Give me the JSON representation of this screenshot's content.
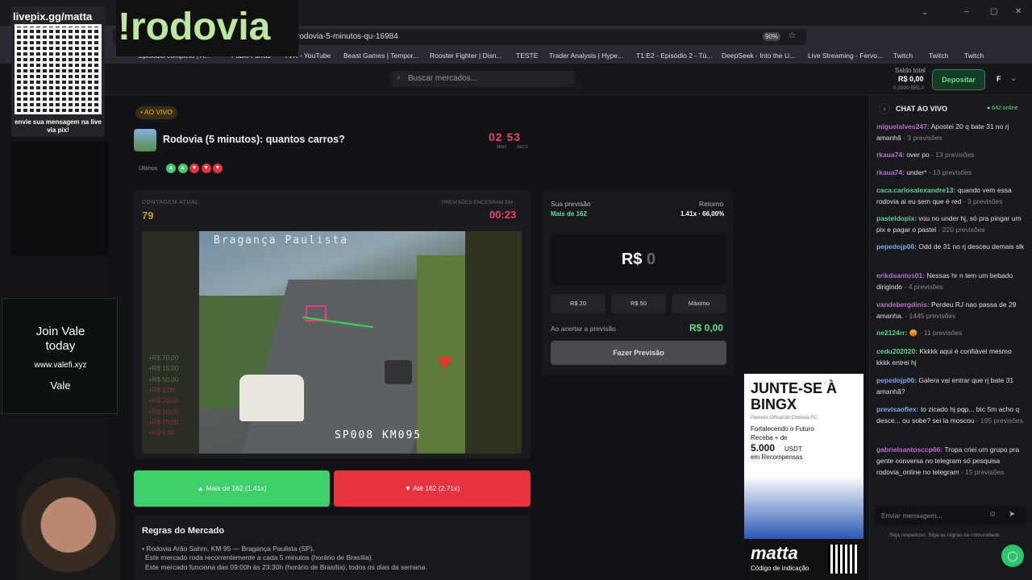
{
  "browser": {
    "url": "rodovia-5-minutos-qu-16984",
    "zoom": "90%",
    "bookmarks": [
      "Episódio completo | A...",
      "Páblo Furras",
      "YVR - YouTube",
      "Beast Games | Tempor...",
      "Rooster Fighter | Disn...",
      "TESTE",
      "Trader Analysis | Hype...",
      "T1:E2 - Episódio 2 - Tú...",
      "DeepSeek - Into the U...",
      "Live Streaming - Fervo...",
      "Twitch",
      "Twitch",
      "Twitch"
    ]
  },
  "header": {
    "search_placeholder": "Buscar mercados...",
    "saldo_label": "Saldo total",
    "saldo_value": "R$ 0,00",
    "saldo_sub": "0.0000 BRLX",
    "deposit": "Depositar",
    "user": "F"
  },
  "market": {
    "live_badge": "• AO VIVO",
    "title": "Rodovia (5 minutos): quantos carros?",
    "timer_min": "02",
    "timer_sec": "53",
    "timer_min_label": "MINS",
    "timer_sec_label": "SECS",
    "ultimos_label": "Últimos",
    "ultimos": [
      "up",
      "up",
      "down",
      "down",
      "down"
    ],
    "contagem_label": "CONTAGEM ATUAL",
    "contagem_value": "79",
    "prev_label": "PREVISÕES ENCERRAM EM",
    "prev_time": "00:23",
    "video_top": "Bragança Paulista",
    "video_bottom": "SP008 KM095",
    "multipliers": [
      "+R$ 70,00",
      "+R$ 15,00",
      "+R$ 50,00",
      "+R$ 2,00",
      "+R$ 20,00",
      "+R$ 10,00",
      "+R$ 10,00",
      "+R$ 5,00"
    ],
    "btn_up": "Mais de 162 (1.41x)",
    "btn_down": "Até 162 (2.71x)"
  },
  "rules": {
    "title": "Regras do Mercado",
    "lines": [
      "• Rodovia Arão Sahm, KM 95 — Bragança Paulista (SP).",
      "Este mercado roda recorrentemente a cada 5 minutos (horário de Brasília).",
      "Este mercado funciona das 09:00h às 23:30h (horário de Brasília), todos os dias da semana."
    ]
  },
  "bet": {
    "sua_label": "Sua previsão",
    "sua_value": "Mais de 162",
    "retorno_label": "Retorno",
    "retorno_value": "1.41x · 66,00%",
    "currency": "R$",
    "amount": "0",
    "chips": [
      "R$ 20",
      "R$ 50",
      "Máximo"
    ],
    "acertar_label": "Ao acertar a previsão",
    "acertar_value": "R$ 0,00",
    "submit": "Fazer Previsão"
  },
  "ad": {
    "headline": "JUNTE-SE À BINGX",
    "sub": "Parceiro Oficial do Chelsea FC",
    "body1": "Fortalecendo o Futuro",
    "body2": "Receba + de",
    "amount": "5.000",
    "unit": "USDT",
    "body3": "em Recompensas",
    "brand": "matta",
    "code": "Código de indicação"
  },
  "chat": {
    "title": "CHAT AO VIVO",
    "online": "● 642 online",
    "input_placeholder": "Enviar mensagem...",
    "footer": "Seja respeitoso. Siga as regras da comunidade",
    "messages": [
      {
        "user": "miguelalves247:",
        "color": "#c46bd6",
        "text": " Apostei 20 q bate 31 no rj amanhã",
        "meta": " - 3 previsões"
      },
      {
        "user": "rkaua74:",
        "color": "#c46bd6",
        "text": " over po",
        "meta": " - 13 previsões"
      },
      {
        "user": "rkaua74:",
        "color": "#c46bd6",
        "text": " under*",
        "meta": " - 13 previsões"
      },
      {
        "user": "caca.carlosalexandre13:",
        "color": "#5fd38a",
        "text": " quando vem essa rodovia ai eu sem que é red",
        "meta": " - 3 previsões"
      },
      {
        "user": "pasteldopix:",
        "color": "#5fd38a",
        "text": " vou no under hj, só pra pingar um pix e pagar o pastel",
        "meta": " - 220 previsões"
      },
      {
        "user": "pepedojp06:",
        "color": "#7aa8f0",
        "text": " Odd de 31 no rj desceu demais slk",
        "meta": ""
      },
      {
        "user": "erikdsantos01:",
        "color": "#c46bd6",
        "text": " Nessas hr n tem um bebado dirigindo",
        "meta": " - 4 previsões"
      },
      {
        "user": "vandebergdinis:",
        "color": "#c46bd6",
        "text": " Perdeu RJ nao passa de 29 amanha.",
        "meta": " - 1445 previsões"
      },
      {
        "user": "ne2124rr:",
        "color": "#5fd38a",
        "text": " 😡",
        "meta": " - 11 previsões"
      },
      {
        "user": "cedu202020:",
        "color": "#5fd38a",
        "text": " Kkkkk aqui é confiável mesmo kkkk entrei hj",
        "meta": ""
      },
      {
        "user": "pepedojp06:",
        "color": "#7aa8f0",
        "text": " Galera vai entrar que rj bate 31 amanhã?",
        "meta": ""
      },
      {
        "user": "previsaoflex:",
        "color": "#7aa8f0",
        "text": " to zicado hj pqp... btc 5m acho q desce... ou sobe? sei la moscou",
        "meta": " - 195 previsões"
      },
      {
        "user": "gabrielsantosccp66:",
        "color": "#c46bd6",
        "text": " Tropa criei um grupo pra gente conversa no telegram só pesquisa rodovia_online no telegram",
        "meta": " - 15 previsões"
      }
    ]
  },
  "overlay": {
    "livepix": "livepix.gg/matta",
    "livepix_msg": "envie sua mensagem na live via pix!",
    "command": "!rodovia",
    "vale1": "Join Vale",
    "vale2": "today",
    "vale_url": "www.valefi.xyz",
    "vale_brand": "Vale"
  }
}
